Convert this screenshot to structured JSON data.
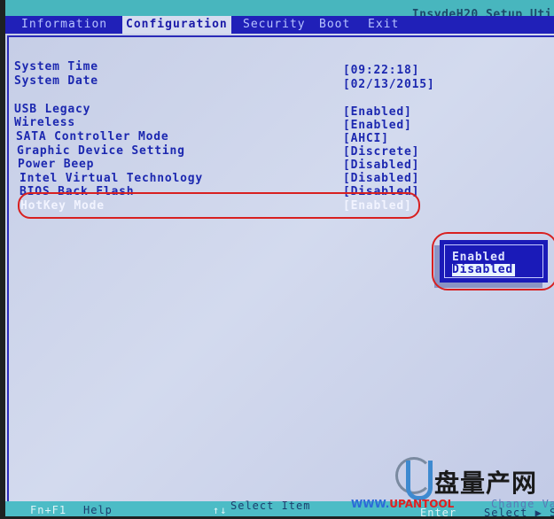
{
  "app_title": "InsydeH20 Setup Uti",
  "tabs": [
    {
      "label": "Information",
      "active": false
    },
    {
      "label": "Configuration",
      "active": true
    },
    {
      "label": "Security",
      "active": false
    },
    {
      "label": "Boot",
      "active": false
    },
    {
      "label": "Exit",
      "active": false
    }
  ],
  "settings": [
    {
      "label": "System Time",
      "value": "[09:22:18]"
    },
    {
      "label": "System Date",
      "value": "[02/13/2015]"
    },
    {
      "label": "USB Legacy",
      "value": "[Enabled]"
    },
    {
      "label": "Wireless",
      "value": "[Enabled]"
    },
    {
      "label": "SATA Controller Mode",
      "value": "[AHCI]"
    },
    {
      "label": "Graphic Device Setting",
      "value": "[Discrete]"
    },
    {
      "label": "Power Beep",
      "value": "[Disabled]"
    },
    {
      "label": "Intel Virtual Technology",
      "value": "[Disabled]"
    },
    {
      "label": "BIOS Back Flash",
      "value": "[Disabled]"
    },
    {
      "label": "HotKey Mode",
      "value": "[Enabled]",
      "highlighted": true
    }
  ],
  "popup": {
    "options": [
      "Enabled",
      "Disabled"
    ],
    "selected": "Disabled"
  },
  "footer": {
    "help_key": "Fn+F1",
    "help_label": "Help",
    "select_item_key": "↑↓",
    "select_item_label": "Select Item",
    "change_values_label": "Change Values",
    "enter_key": "Enter",
    "select_sub_label": "Select ▶ Su"
  },
  "watermark": {
    "cn": "盘量产网",
    "www": "WWW.",
    "brand": "UPANTOOL"
  },
  "colors": {
    "menubar": "#2020b8",
    "accent_text": "#1c28b0",
    "highlight_ring": "#d82020",
    "footer": "#4cbcc6"
  }
}
